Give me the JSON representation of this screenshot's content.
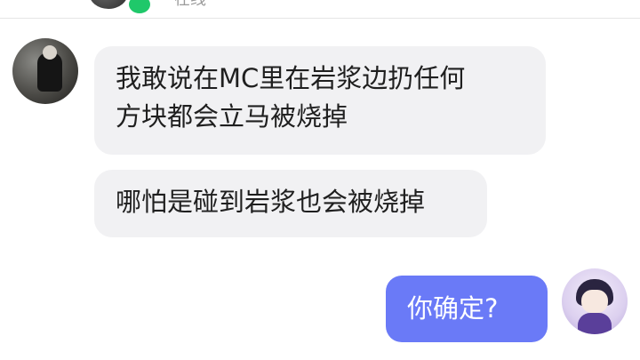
{
  "header": {
    "status": "在线",
    "avatar_icon": "user-avatar-icon",
    "online_indicator_color": "#1fc86a"
  },
  "messages": [
    {
      "side": "incoming",
      "text": "我敢说在MC里在岩浆边扔任何\n方块都会立马被烧掉"
    },
    {
      "side": "incoming",
      "text": "哪怕是碰到岩浆也会被烧掉"
    },
    {
      "side": "outgoing",
      "text": "你确定?"
    }
  ],
  "colors": {
    "incoming_bubble": "#f1f1f3",
    "outgoing_bubble": "#6a7af7",
    "background": "#ffffff"
  }
}
